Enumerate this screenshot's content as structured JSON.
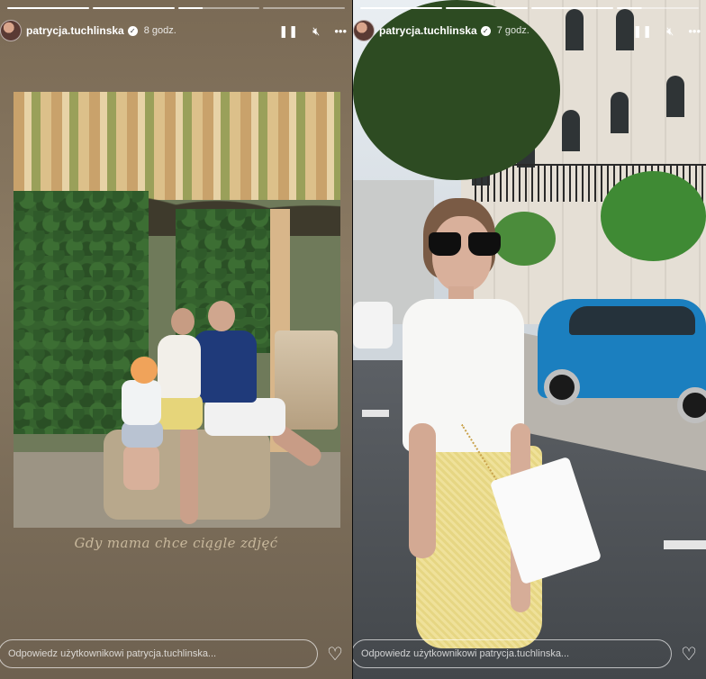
{
  "stories": [
    {
      "username": "patrycja.tuchlinska",
      "time_ago": "8 godz.",
      "caption": "Gdy mama chce ciągle zdjęć",
      "reply_placeholder": "Odpowiedz użytkownikowi patrycja.tuchlinska...",
      "progress_segments": 4
    },
    {
      "username": "patrycja.tuchlinska",
      "time_ago": "7 godz.",
      "reply_placeholder": "Odpowiedz użytkownikowi patrycja.tuchlinska...",
      "progress_segments": 4
    }
  ],
  "icons": {
    "pause": "pause-icon",
    "mute": "mute-icon",
    "more": "more-icon",
    "heart": "heart-icon",
    "verified": "verified-badge-icon"
  },
  "colors": {
    "left_background": "#7a6a55",
    "caption_color": "#c8b89c",
    "car_color": "#1b7fbf",
    "skirt_color": "#efe19a"
  }
}
